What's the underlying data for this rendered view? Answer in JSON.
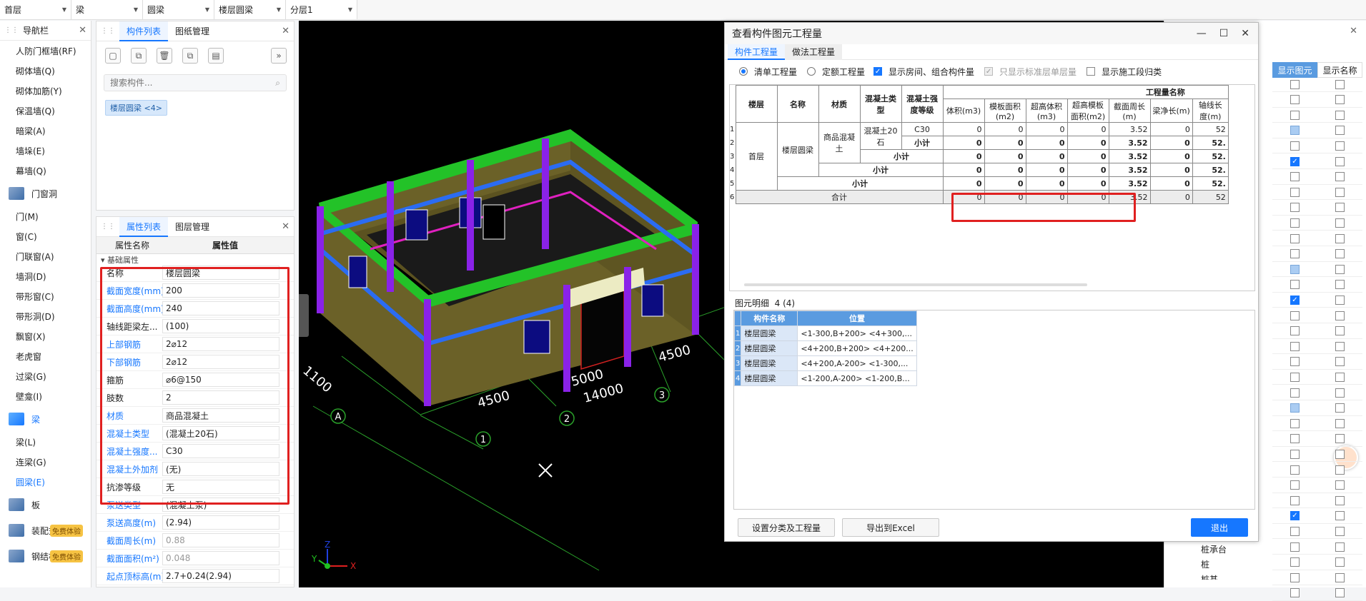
{
  "topbar": {
    "floor": "首层",
    "type": "梁",
    "subtype": "圆梁",
    "component": "楼层圆梁",
    "layer": "分层1"
  },
  "nav": {
    "title": "导航栏",
    "items_top": [
      "人防门框墙(RF)",
      "砌体墙(Q)",
      "砌体加筋(Y)",
      "保温墙(Q)",
      "暗梁(A)",
      "墙垛(E)",
      "幕墙(Q)"
    ],
    "cat_doors": "门窗洞",
    "items_doors": [
      "门(M)",
      "窗(C)",
      "门联窗(A)",
      "墙洞(D)",
      "带形窗(C)",
      "带形洞(D)",
      "飘窗(X)",
      "老虎窗",
      "过梁(G)",
      "壁龛(I)"
    ],
    "cat_beam": "梁",
    "items_beam": [
      "梁(L)",
      "连梁(G)",
      "圆梁(E)"
    ],
    "cat_slab": "板",
    "cat_deco": "装配式",
    "cat_steel": "钢结构",
    "trial": "免费体验"
  },
  "comp": {
    "tab1": "构件列表",
    "tab2": "图纸管理",
    "search_placeholder": "搜索构件...",
    "chip": "楼层圆梁 <4>"
  },
  "prop": {
    "tab1": "属性列表",
    "tab2": "图层管理",
    "col_name": "属性名称",
    "col_value": "属性值",
    "group": "基础属性",
    "rows": [
      {
        "name": "名称",
        "value": "楼层圆梁"
      },
      {
        "name": "截面宽度(mm)",
        "value": "200"
      },
      {
        "name": "截面高度(mm)",
        "value": "240"
      },
      {
        "name": "轴线距梁左...",
        "value": "(100)"
      },
      {
        "name": "上部钢筋",
        "value": "2⌀12"
      },
      {
        "name": "下部钢筋",
        "value": "2⌀12"
      },
      {
        "name": "箍筋",
        "value": "⌀6@150"
      },
      {
        "name": "肢数",
        "value": "2"
      },
      {
        "name": "材质",
        "value": "商品混凝土"
      },
      {
        "name": "混凝土类型",
        "value": "(混凝土20石)"
      },
      {
        "name": "混凝土强度...",
        "value": "C30"
      },
      {
        "name": "混凝土外加剂",
        "value": "(无)"
      },
      {
        "name": "抗渗等级",
        "value": "无"
      },
      {
        "name": "泵送类型",
        "value": "(混凝土泵)"
      },
      {
        "name": "泵送高度(m)",
        "value": "(2.94)"
      },
      {
        "name": "截面周长(m)",
        "value": "0.88"
      },
      {
        "name": "截面面积(m²)",
        "value": "0.048"
      },
      {
        "name": "起点顶标高(m)",
        "value": "2.7+0.24(2.94)"
      }
    ]
  },
  "view": {
    "dims": [
      "1100",
      "4500",
      "5000",
      "14000",
      "4500"
    ],
    "axes": [
      "A",
      "1",
      "2",
      "3"
    ],
    "triad": [
      "X",
      "Y",
      "Z"
    ]
  },
  "dialog": {
    "title": "查看构件图元工程量",
    "tab1": "构件工程量",
    "tab2": "做法工程量",
    "opt1": "清单工程量",
    "opt2": "定额工程量",
    "opt3": "显示房间、组合构件量",
    "opt4": "只显示标准层单层量",
    "opt5": "显示施工段归类",
    "header_group": "工程量名称",
    "headers": [
      "楼层",
      "名称",
      "材质",
      "混凝土类型",
      "混凝土强度等级",
      "体积(m3)",
      "模板面积(m2)",
      "超高体积(m3)",
      "超高模板面积(m2)",
      "截面周长(m)",
      "梁净长(m)",
      "轴线长度(m)"
    ],
    "floor": "首层",
    "name": "楼层圆梁",
    "material": "商品混凝土",
    "concrete": "混凝土20石",
    "grade": "C30",
    "subtotal": "小计",
    "total": "合计",
    "rows": [
      [
        "0",
        "0",
        "0",
        "0",
        "3.52",
        "0",
        "52"
      ],
      [
        "0",
        "0",
        "0",
        "0",
        "3.52",
        "0",
        "52."
      ],
      [
        "0",
        "0",
        "0",
        "0",
        "3.52",
        "0",
        "52."
      ],
      [
        "0",
        "0",
        "0",
        "0",
        "3.52",
        "0",
        "52."
      ],
      [
        "0",
        "0",
        "0",
        "0",
        "3.52",
        "0",
        "52."
      ],
      [
        "0",
        "0",
        "0",
        "0",
        "3.52",
        "0",
        "52"
      ]
    ],
    "detail_label": "图元明细",
    "detail_count": "4 (4)",
    "detail_cols": [
      "构件名称",
      "位置"
    ],
    "detail_rows": [
      [
        "楼层圆梁",
        "<1-300,B+200> <4+300,..."
      ],
      [
        "楼层圆梁",
        "<4+200,B+200> <4+200..."
      ],
      [
        "楼层圆梁",
        "<4+200,A-200> <1-300,..."
      ],
      [
        "楼层圆梁",
        "<1-200,A-200> <1-200,B..."
      ]
    ],
    "btn_settings": "设置分类及工程量",
    "btn_export": "导出到Excel",
    "btn_exit": "退出"
  },
  "right": {
    "col1": "显示图元",
    "col2": "显示名称",
    "labels": [
      "桩承台",
      "桩",
      "桩基"
    ],
    "checks": [
      [
        0,
        0
      ],
      [
        0,
        0
      ],
      [
        0,
        0
      ],
      [
        2,
        0
      ],
      [
        0,
        0
      ],
      [
        1,
        0
      ],
      [
        0,
        0
      ],
      [
        0,
        0
      ],
      [
        0,
        0
      ],
      [
        0,
        0
      ],
      [
        0,
        0
      ],
      [
        0,
        0
      ],
      [
        2,
        0
      ],
      [
        0,
        0
      ],
      [
        1,
        0
      ],
      [
        0,
        0
      ],
      [
        0,
        0
      ],
      [
        0,
        0
      ],
      [
        0,
        0
      ],
      [
        0,
        0
      ],
      [
        0,
        0
      ],
      [
        2,
        0
      ],
      [
        0,
        0
      ],
      [
        0,
        0
      ],
      [
        0,
        0
      ],
      [
        0,
        0
      ],
      [
        0,
        0
      ],
      [
        0,
        0
      ],
      [
        1,
        0
      ],
      [
        0,
        0
      ],
      [
        0,
        0
      ],
      [
        0,
        0
      ],
      [
        0,
        0
      ],
      [
        0,
        0
      ]
    ]
  }
}
